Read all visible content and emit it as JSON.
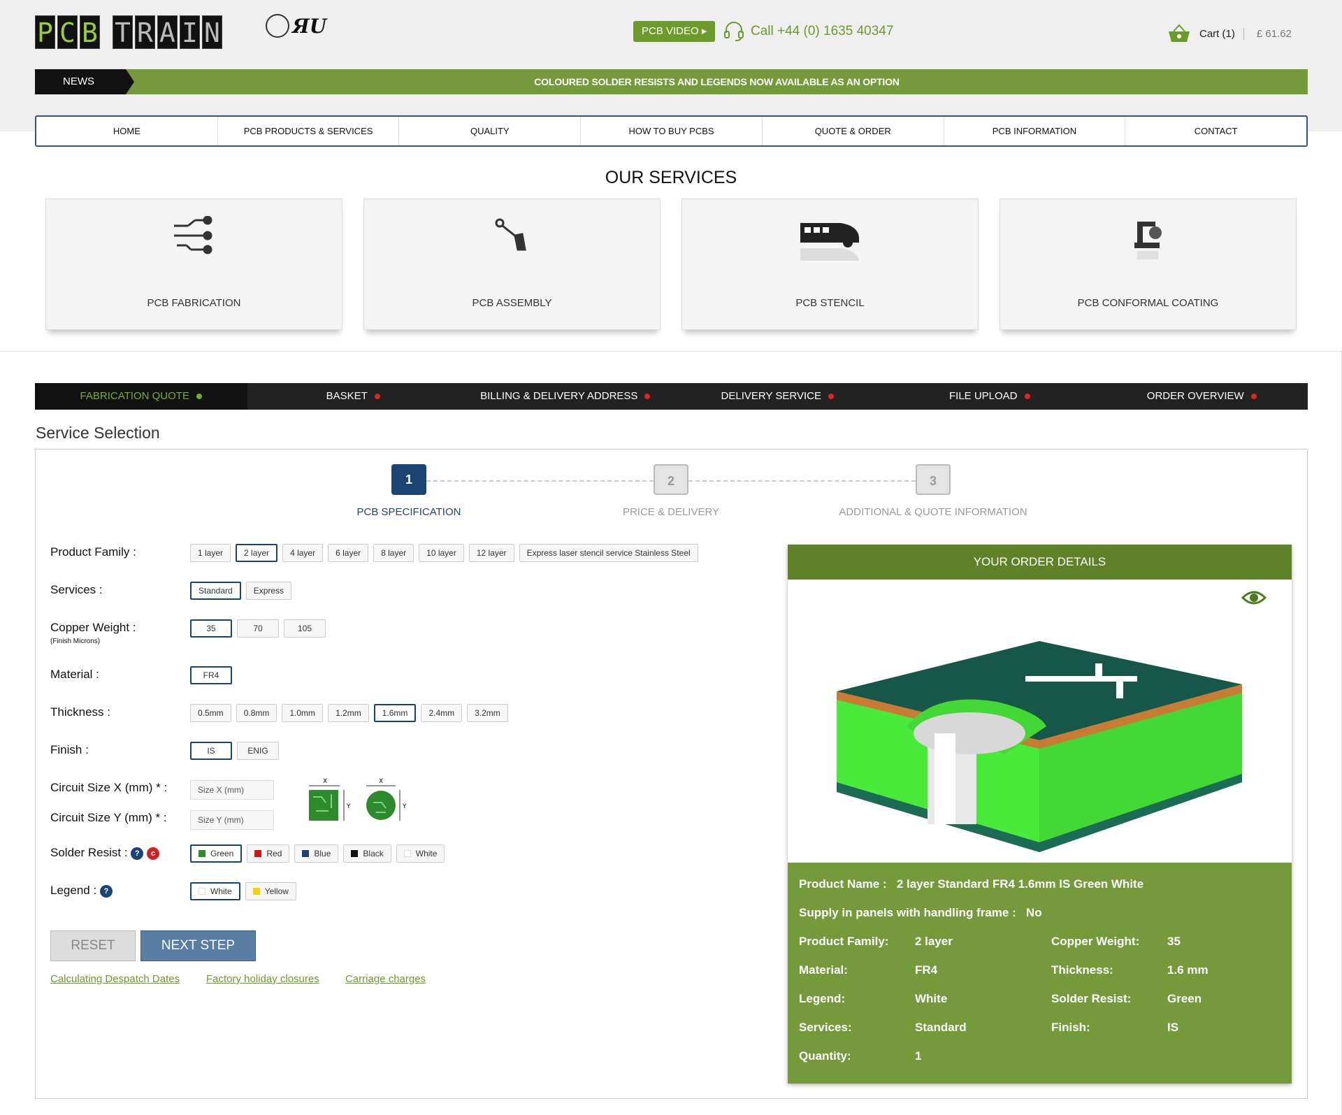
{
  "header": {
    "logo_letters": [
      "P",
      "C",
      "B",
      "T",
      "R",
      "A",
      "I",
      "N"
    ],
    "video_label": "PCB VIDEO ▸",
    "phone_label": "Call +44 (0) 1635 40347",
    "cart_label": "Cart (1)",
    "cart_amount": "£ 61.62"
  },
  "news": {
    "label": "NEWS",
    "text": "COLOURED SOLDER RESISTS AND LEGENDS NOW AVAILABLE AS AN OPTION"
  },
  "menu": [
    "HOME",
    "PCB PRODUCTS & SERVICES",
    "QUALITY",
    "HOW TO BUY PCBS",
    "QUOTE & ORDER",
    "PCB INFORMATION",
    "CONTACT"
  ],
  "services": {
    "title": "OUR SERVICES",
    "cards": [
      "PCB FABRICATION",
      "PCB ASSEMBLY",
      "PCB STENCIL",
      "PCB CONFORMAL COATING"
    ]
  },
  "steps": [
    "FABRICATION QUOTE",
    "BASKET",
    "BILLING & DELIVERY ADDRESS",
    "DELIVERY SERVICE",
    "FILE UPLOAD",
    "ORDER OVERVIEW"
  ],
  "service_selection": "Service Selection",
  "wizard": [
    {
      "num": "1",
      "label": "PCB SPECIFICATION"
    },
    {
      "num": "2",
      "label": "PRICE & DELIVERY"
    },
    {
      "num": "3",
      "label": "ADDITIONAL & QUOTE INFORMATION"
    }
  ],
  "form": {
    "product_family": {
      "label": "Product Family :",
      "options": [
        "1 layer",
        "2 layer",
        "4 layer",
        "6 layer",
        "8 layer",
        "10 layer",
        "12 layer",
        "Express laser stencil service Stainless Steel"
      ],
      "selected": "2 layer"
    },
    "services": {
      "label": "Services :",
      "options": [
        "Standard",
        "Express"
      ],
      "selected": "Standard"
    },
    "copper": {
      "label": "Copper Weight :",
      "sublabel": "(Finish Microns)",
      "options": [
        "35",
        "70",
        "105"
      ],
      "selected": "35"
    },
    "material": {
      "label": "Material :",
      "options": [
        "FR4"
      ],
      "selected": "FR4"
    },
    "thickness": {
      "label": "Thickness :",
      "options": [
        "0.5mm",
        "0.8mm",
        "1.0mm",
        "1.2mm",
        "1.6mm",
        "2.4mm",
        "3.2mm"
      ],
      "selected": "1.6mm"
    },
    "finish": {
      "label": "Finish :",
      "options": [
        "IS",
        "ENIG"
      ],
      "selected": "IS"
    },
    "size_x": {
      "label": "Circuit Size X (mm) * :",
      "placeholder": "Size X (mm)"
    },
    "size_y": {
      "label": "Circuit Size Y (mm) * :",
      "placeholder": "Size Y (mm)"
    },
    "solder": {
      "label": "Solder Resist :",
      "options": [
        {
          "name": "Green",
          "color": "#2e8b2e"
        },
        {
          "name": "Red",
          "color": "#d01818"
        },
        {
          "name": "Blue",
          "color": "#1c3f7a"
        },
        {
          "name": "Black",
          "color": "#111111"
        },
        {
          "name": "White",
          "color": "#ffffff"
        }
      ],
      "selected": "Green"
    },
    "legend": {
      "label": "Legend :",
      "options": [
        {
          "name": "White",
          "color": "#ffffff"
        },
        {
          "name": "Yellow",
          "color": "#f2d20b"
        }
      ],
      "selected": "White"
    },
    "reset": "RESET",
    "next": "NEXT STEP",
    "links": [
      "Calculating Despatch Dates",
      "Factory holiday closures",
      "Carriage charges"
    ]
  },
  "order": {
    "title": "YOUR ORDER DETAILS",
    "product_name_label": "Product Name :",
    "product_name": "2 layer Standard FR4 1.6mm IS Green White",
    "panels_label": "Supply in panels with handling frame :",
    "panels": "No",
    "rows": [
      {
        "l1": "Product Family:",
        "v1": "2 layer",
        "l2": "Copper Weight:",
        "v2": "35"
      },
      {
        "l1": "Material:",
        "v1": "FR4",
        "l2": "Thickness:",
        "v2": "1.6 mm"
      },
      {
        "l1": "Legend:",
        "v1": "White",
        "l2": "Solder Resist:",
        "v2": "Green"
      },
      {
        "l1": "Services:",
        "v1": "Standard",
        "l2": "Finish:",
        "v2": "IS"
      },
      {
        "l1": "Quantity:",
        "v1": "1",
        "l2": "",
        "v2": ""
      }
    ]
  },
  "colors": {
    "brand_green": "#749a3b",
    "navy": "#1c4473"
  }
}
